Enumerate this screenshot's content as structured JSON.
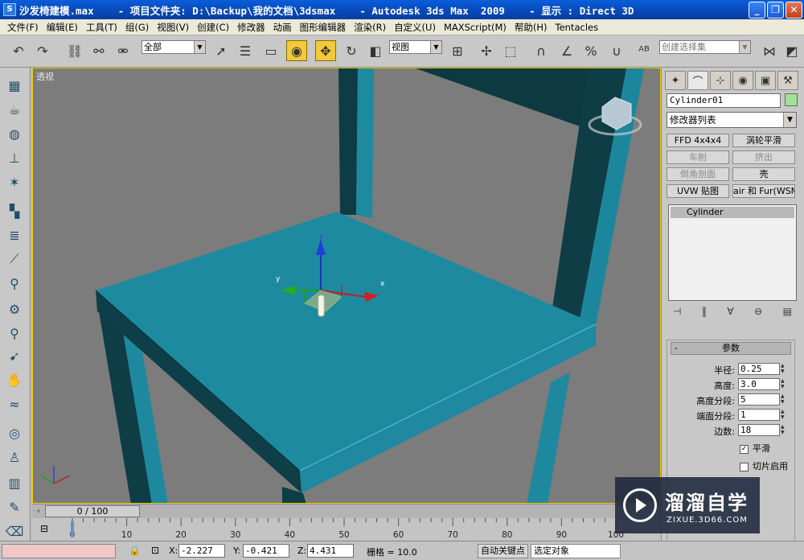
{
  "titlebar": {
    "title": "沙发椅建模.max    - 项目文件夹: D:\\Backup\\我的文档\\3dsmax    - Autodesk 3ds Max  2009    - 显示 : Direct 3D"
  },
  "menu": [
    "文件(F)",
    "编辑(E)",
    "工具(T)",
    "组(G)",
    "视图(V)",
    "创建(C)",
    "修改器",
    "动画",
    "图形编辑器",
    "渲染(R)",
    "自定义(U)",
    "MAXScript(M)",
    "帮助(H)",
    "Tentacles"
  ],
  "toolbar": {
    "selection_filter": "全部",
    "reference_coord": "视图",
    "named_selection": "创建选择集"
  },
  "viewport": {
    "label": "透视",
    "gizmo_axes": {
      "x": "x",
      "y": "y",
      "z": "z"
    }
  },
  "command_panel": {
    "object_name": "Cylinder01",
    "modifier_list": "修改器列表",
    "modifier_buttons": [
      {
        "label": "FFD 4x4x4",
        "enabled": true
      },
      {
        "label": "涡轮平滑",
        "enabled": true
      },
      {
        "label": "车削",
        "enabled": false
      },
      {
        "label": "挤出",
        "enabled": false
      },
      {
        "label": "倒角剖面",
        "enabled": false
      },
      {
        "label": "壳",
        "enabled": true
      },
      {
        "label": "UVW 贴图",
        "enabled": true
      },
      {
        "label": "air 和 Fur(WSM",
        "enabled": true
      }
    ],
    "stack_item": "Cylinder",
    "rollout": {
      "minus": "-",
      "title": "参数",
      "params": [
        {
          "label": "半径:",
          "value": "0.25"
        },
        {
          "label": "高度:",
          "value": "3.0"
        },
        {
          "label": "高度分段:",
          "value": "5"
        },
        {
          "label": "端面分段:",
          "value": "1"
        },
        {
          "label": "边数:",
          "value": "18"
        }
      ],
      "smooth": {
        "label": "平滑",
        "checked": true,
        "mark": "✓"
      },
      "slice": {
        "label": "切片启用",
        "checked": false
      }
    }
  },
  "timeline": {
    "frame_display": "0 / 100",
    "ticks": [
      "0",
      "10",
      "20",
      "30",
      "40",
      "50",
      "60",
      "70",
      "80",
      "90",
      "100"
    ]
  },
  "statusbar": {
    "x_label": "X:",
    "x_value": "-2.227",
    "y_label": "Y:",
    "y_value": "-0.421",
    "z_label": "Z:",
    "z_value": "4.431",
    "grid": "栅格 = 10.0",
    "auto_key": "自动关键点",
    "selection_set": "选定对象"
  },
  "watermark": {
    "title": "溜溜自学",
    "url": "ZIXUE.3D66.COM"
  }
}
